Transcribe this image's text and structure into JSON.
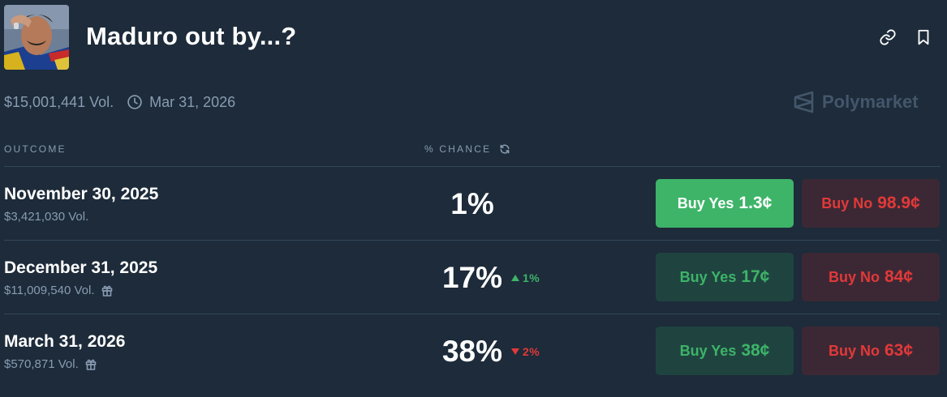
{
  "market": {
    "title": "Maduro out by...?",
    "volume": "$15,001,441 Vol.",
    "end_date": "Mar 31, 2026",
    "brand": "Polymarket"
  },
  "columns": {
    "outcome": "OUTCOME",
    "chance": "% CHANCE"
  },
  "icons": {
    "link": "link-icon",
    "bookmark": "bookmark-icon",
    "clock": "clock-icon",
    "refresh": "refresh-icon",
    "gift": "gift-icon",
    "brand_logo": "polymarket-logo-icon"
  },
  "colors": {
    "background": "#1d2b3a",
    "yes_green": "#3db468",
    "no_red": "#e23939",
    "muted_text": "#899cb2"
  },
  "outcomes": [
    {
      "date": "November 30, 2025",
      "volume": "$3,421,030 Vol.",
      "chance": "1%",
      "delta": "",
      "delta_dir": "",
      "has_gift": false,
      "yes_label": "Buy Yes",
      "yes_price": "1.3¢",
      "no_label": "Buy No",
      "no_price": "98.9¢",
      "yes_active": true
    },
    {
      "date": "December 31, 2025",
      "volume": "$11,009,540 Vol.",
      "chance": "17%",
      "delta": "1%",
      "delta_dir": "up",
      "has_gift": true,
      "yes_label": "Buy Yes",
      "yes_price": "17¢",
      "no_label": "Buy No",
      "no_price": "84¢",
      "yes_active": false
    },
    {
      "date": "March 31, 2026",
      "volume": "$570,871 Vol.",
      "chance": "38%",
      "delta": "2%",
      "delta_dir": "down",
      "has_gift": true,
      "yes_label": "Buy Yes",
      "yes_price": "38¢",
      "no_label": "Buy No",
      "no_price": "63¢",
      "yes_active": false
    }
  ]
}
